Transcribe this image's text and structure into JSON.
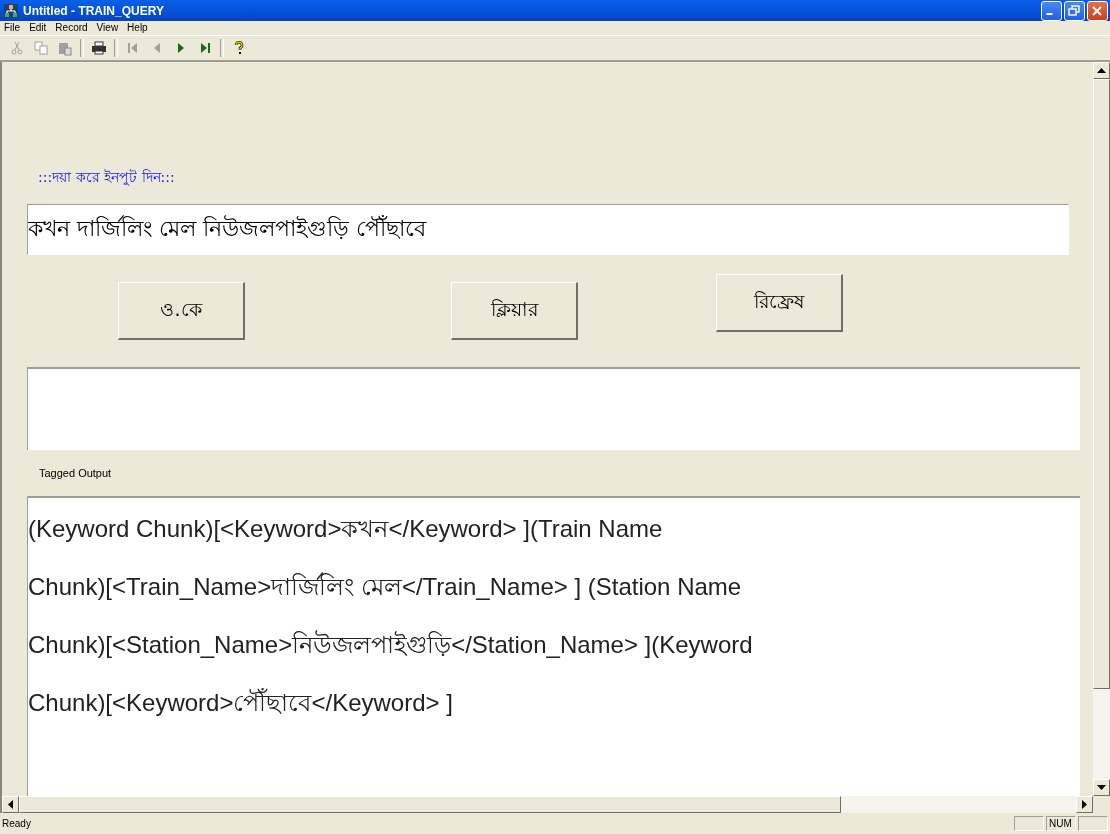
{
  "window": {
    "title": "Untitled - TRAIN_QUERY"
  },
  "menu": [
    "File",
    "Edit",
    "Record",
    "View",
    "Help"
  ],
  "toolbar": [
    {
      "kind": "cut",
      "disabled": true
    },
    {
      "kind": "copy",
      "disabled": true
    },
    {
      "kind": "paste",
      "disabled": true
    },
    {
      "kind": "sep"
    },
    {
      "kind": "print",
      "disabled": false
    },
    {
      "kind": "sep"
    },
    {
      "kind": "first",
      "disabled": true
    },
    {
      "kind": "prev",
      "disabled": true
    },
    {
      "kind": "next",
      "disabled": false
    },
    {
      "kind": "last",
      "disabled": false
    },
    {
      "kind": "sep"
    },
    {
      "kind": "help",
      "disabled": false
    }
  ],
  "form": {
    "prompt": ":::দয়া করে ইনপুট দিন:::",
    "input": {
      "value": "কখন দার্জিলিং মেল নিউজলপাইগুড়ি পৌঁছাবে"
    },
    "buttons": [
      "ও.কে",
      "ক্লিয়ার",
      "রিফ্রেষ"
    ],
    "output_label": "Tagged Output",
    "tagged_output": [
      "(Keyword Chunk)[<Keyword>কখন</Keyword> ](Train Name",
      "Chunk)[<Train_Name>দার্জিলিং মেল</Train_Name> ] (Station Name",
      "Chunk)[<Station_Name>নিউজলপাইগুড়ি</Station_Name> ](Keyword",
      "Chunk)[<Keyword>পৌঁছাবে</Keyword> ]"
    ]
  },
  "status_bar": {
    "text": "Ready",
    "indicators": [
      "NUM"
    ]
  }
}
